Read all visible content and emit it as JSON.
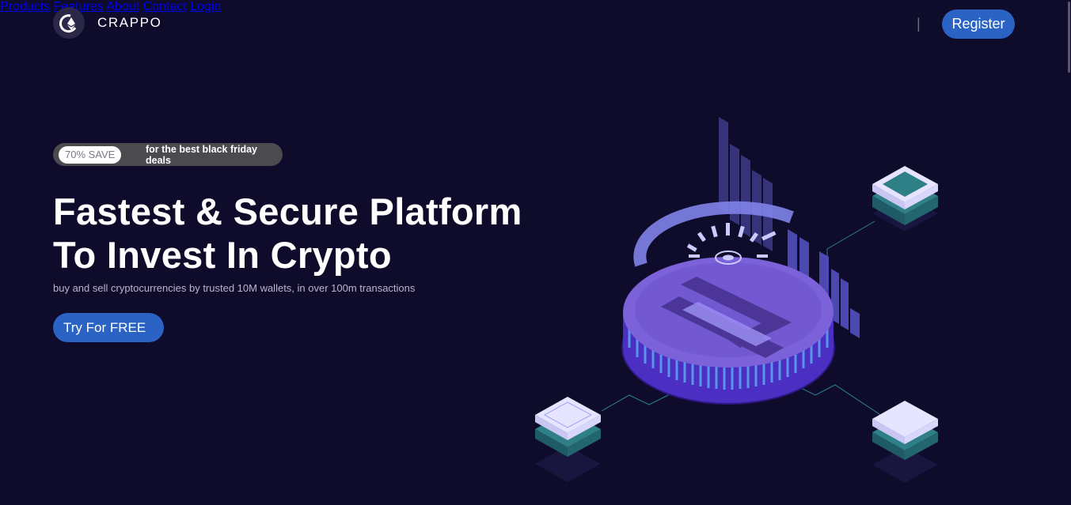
{
  "brand": {
    "name": "CRAPPO",
    "logo_icon": "ethereum-icon"
  },
  "nav": {
    "items": [
      {
        "label": "Products"
      },
      {
        "label": "Features"
      },
      {
        "label": "About"
      },
      {
        "label": "Contact"
      }
    ],
    "login_label": "Login",
    "divider": "|",
    "register_label": "Register"
  },
  "promo": {
    "badge": "70% SAVE",
    "text": "for the best black friday deals"
  },
  "hero": {
    "title_line1": "Fastest & Secure Platform",
    "title_line2": "To Invest In Crypto",
    "subtitle": "buy and sell cryptocurrencies by trusted 10M wallets, in over 100m transactions",
    "cta_label": "Try For FREE"
  },
  "colors": {
    "background": "#0e0b2b",
    "accent": "#2a63c4",
    "coin": "#7b62d9",
    "teal": "#2e7f86"
  }
}
